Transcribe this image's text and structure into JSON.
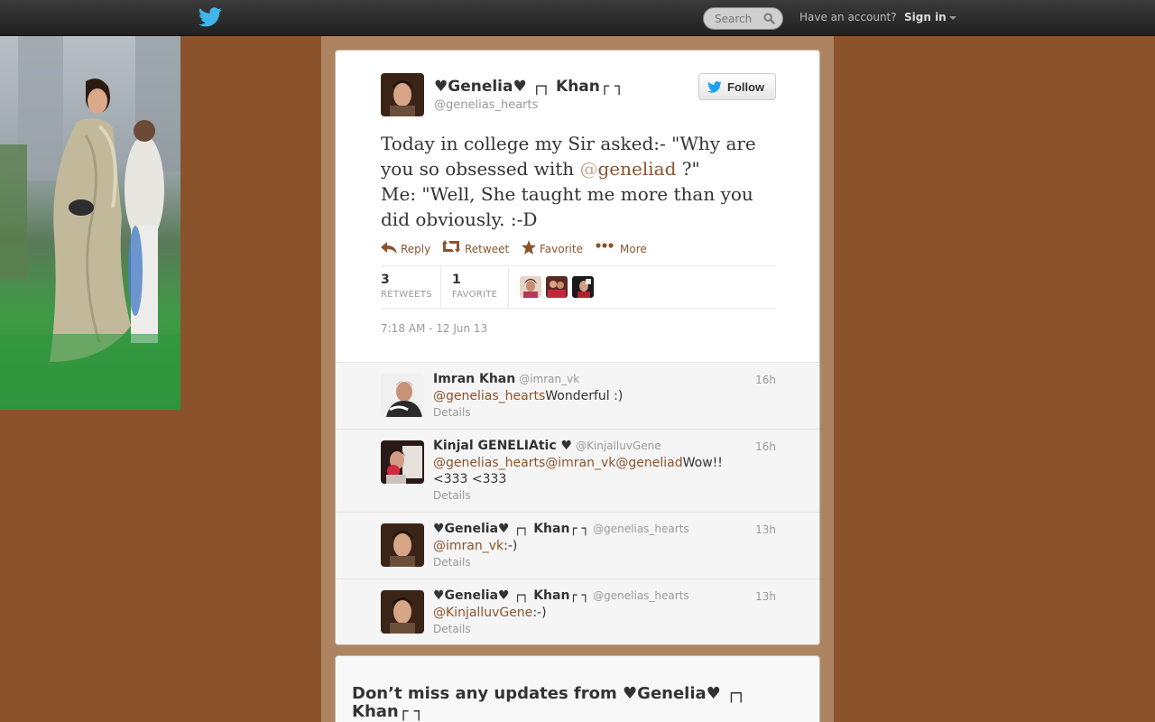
{
  "topbar": {
    "search_placeholder": "Search",
    "have_account": "Have an account?",
    "sign_in": "Sign in"
  },
  "tweet": {
    "fullname": "♥Genelia♥ ┌┐ Khan┌ ┐",
    "screen_name": "@genelias_hearts",
    "follow_label": "Follow",
    "text_part1": "Today in college my Sir asked:-   \"Why are you so obsessed with ",
    "mention_at": "@",
    "mention_name": "geneliad",
    "text_part2": " ?\"",
    "text_line2": "Me: \"Well, She taught me more than you did obviously. :-D",
    "actions": {
      "reply": "Reply",
      "retweet": "Retweet",
      "favorite": "Favorite",
      "more": "More"
    },
    "retweets_count": "3",
    "retweets_label": "RETWEETS",
    "favorites_count": "1",
    "favorites_label": "FAVORITE",
    "timestamp": "7:18 AM - 12 Jun 13"
  },
  "replies": [
    {
      "name": "Imran Khan",
      "handle": "@imran_vk",
      "time": "16h",
      "mentions": [
        "@genelias_hearts"
      ],
      "text": "Wonderful :)",
      "details": "Details"
    },
    {
      "name": "Kinjal GENELIAtic ♥",
      "handle": "@KinjalluvGene",
      "time": "16h",
      "mentions": [
        "@genelias_hearts",
        "@imran_vk",
        "@geneliad"
      ],
      "text": "Wow!!",
      "text_line2": "<333 <333",
      "details": "Details"
    },
    {
      "name": "♥Genelia♥ ┌┐ Khan┌ ┐",
      "handle": "@genelias_hearts",
      "time": "13h",
      "mentions": [
        "@imran_vk"
      ],
      "text": ":-)",
      "details": "Details"
    },
    {
      "name": "♥Genelia♥ ┌┐ Khan┌ ┐",
      "handle": "@genelias_hearts",
      "time": "13h",
      "mentions": [
        "@KinjalluvGene"
      ],
      "text": ":-)",
      "details": "Details"
    }
  ],
  "signup": {
    "headline": "Don’t miss any updates from ♥Genelia♥ ┌┐ Khan┌ ┐"
  },
  "colors": {
    "background": "#8b532c",
    "link": "#8b532c",
    "twitter_blue": "#1da1f2"
  }
}
